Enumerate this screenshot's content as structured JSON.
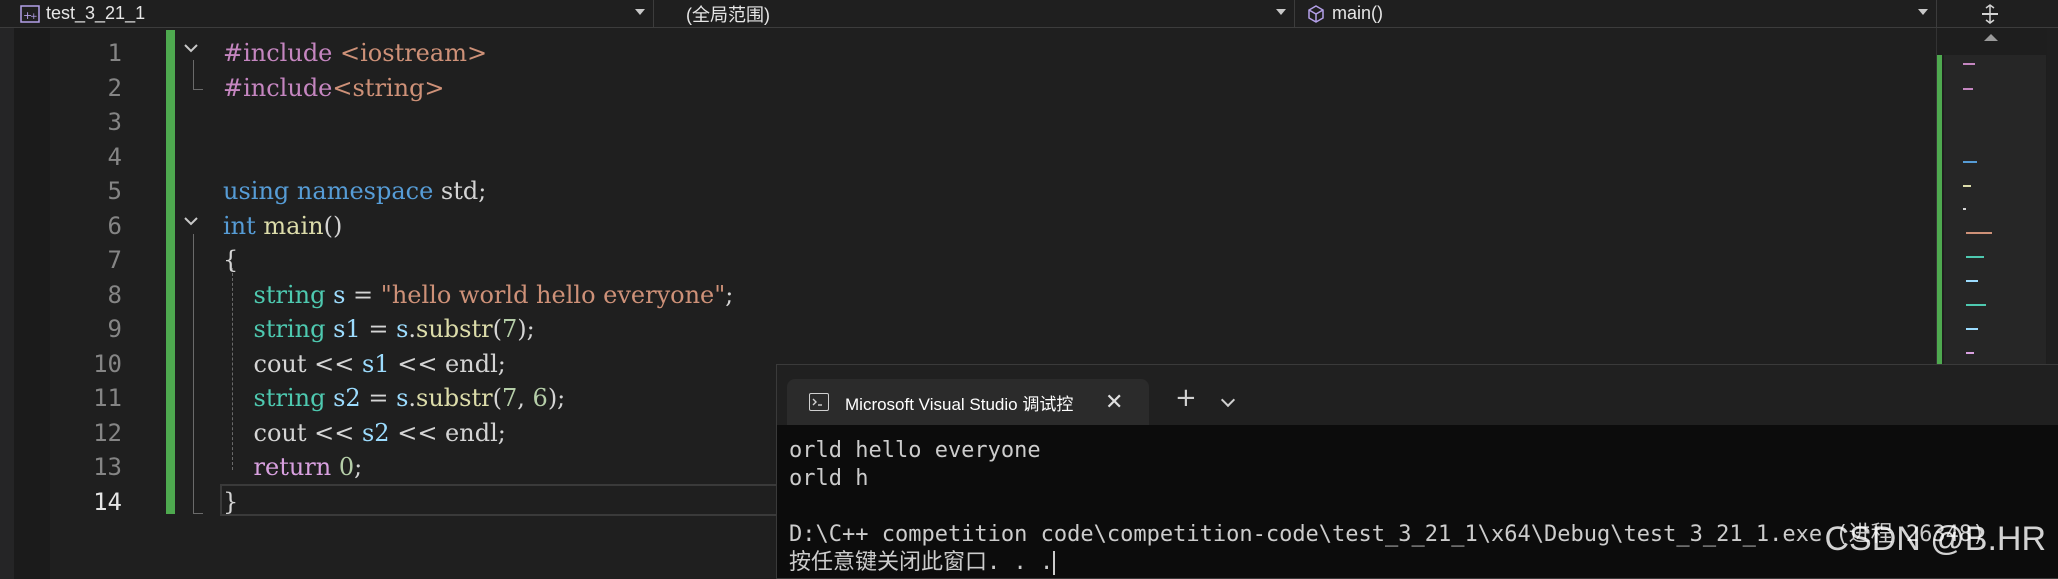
{
  "navbar": {
    "project": "test_3_21_1",
    "scope": "(全局范围)",
    "member": "main()"
  },
  "editor": {
    "line_numbers": [
      "1",
      "2",
      "3",
      "4",
      "5",
      "6",
      "7",
      "8",
      "9",
      "10",
      "11",
      "12",
      "13",
      "14"
    ],
    "current_line": "14",
    "lines": [
      [
        {
          "t": "#include ",
          "c": "pp"
        },
        {
          "t": "<iostream>",
          "c": "str"
        }
      ],
      [
        {
          "t": "#include",
          "c": "pp"
        },
        {
          "t": "<string>",
          "c": "str"
        }
      ],
      [],
      [],
      [
        {
          "t": "using",
          "c": "kw"
        },
        {
          "t": " ",
          "c": "plain"
        },
        {
          "t": "namespace",
          "c": "kw"
        },
        {
          "t": " std;",
          "c": "plain"
        }
      ],
      [
        {
          "t": "int",
          "c": "kw"
        },
        {
          "t": " ",
          "c": "plain"
        },
        {
          "t": "main",
          "c": "fn"
        },
        {
          "t": "()",
          "c": "plain"
        }
      ],
      [
        {
          "t": "{",
          "c": "plain"
        }
      ],
      [
        {
          "t": "    ",
          "c": "plain"
        },
        {
          "t": "string",
          "c": "ty"
        },
        {
          "t": " ",
          "c": "plain"
        },
        {
          "t": "s",
          "c": "var"
        },
        {
          "t": " = ",
          "c": "plain"
        },
        {
          "t": "\"hello world hello everyone\"",
          "c": "str"
        },
        {
          "t": ";",
          "c": "plain"
        }
      ],
      [
        {
          "t": "    ",
          "c": "plain"
        },
        {
          "t": "string",
          "c": "ty"
        },
        {
          "t": " ",
          "c": "plain"
        },
        {
          "t": "s1",
          "c": "var"
        },
        {
          "t": " = ",
          "c": "plain"
        },
        {
          "t": "s",
          "c": "var"
        },
        {
          "t": ".",
          "c": "plain"
        },
        {
          "t": "substr",
          "c": "fn"
        },
        {
          "t": "(",
          "c": "plain"
        },
        {
          "t": "7",
          "c": "num"
        },
        {
          "t": ");",
          "c": "plain"
        }
      ],
      [
        {
          "t": "    cout << ",
          "c": "plain"
        },
        {
          "t": "s1",
          "c": "var"
        },
        {
          "t": " << endl;",
          "c": "plain"
        }
      ],
      [
        {
          "t": "    ",
          "c": "plain"
        },
        {
          "t": "string",
          "c": "ty"
        },
        {
          "t": " ",
          "c": "plain"
        },
        {
          "t": "s2",
          "c": "var"
        },
        {
          "t": " = ",
          "c": "plain"
        },
        {
          "t": "s",
          "c": "var"
        },
        {
          "t": ".",
          "c": "plain"
        },
        {
          "t": "substr",
          "c": "fn"
        },
        {
          "t": "(",
          "c": "plain"
        },
        {
          "t": "7",
          "c": "num"
        },
        {
          "t": ", ",
          "c": "plain"
        },
        {
          "t": "6",
          "c": "num"
        },
        {
          "t": ");",
          "c": "plain"
        }
      ],
      [
        {
          "t": "    cout << ",
          "c": "plain"
        },
        {
          "t": "s2",
          "c": "var"
        },
        {
          "t": " << endl;",
          "c": "plain"
        }
      ],
      [
        {
          "t": "    ",
          "c": "plain"
        },
        {
          "t": "return",
          "c": "ctl"
        },
        {
          "t": " ",
          "c": "plain"
        },
        {
          "t": "0",
          "c": "num"
        },
        {
          "t": ";",
          "c": "plain"
        }
      ],
      [
        {
          "t": "}",
          "c": "plain"
        }
      ]
    ]
  },
  "terminal": {
    "tab_title": "Microsoft Visual Studio 调试控",
    "output": [
      "orld hello everyone",
      "orld h",
      "",
      "D:\\C++ competition code\\competition-code\\test_3_21_1\\x64\\Debug\\test_3_21_1.exe (进程 26348)",
      "按任意键关闭此窗口. . ."
    ]
  },
  "watermark": "CSDN @B.HR",
  "colors": {
    "background": "#1f1f1f",
    "change_bar": "#4ea94f",
    "keyword": "#569cd6",
    "type": "#4ec9b0",
    "function": "#dcdcaa",
    "string": "#ce9178",
    "number": "#b5cea8",
    "variable": "#9cdcfe",
    "terminal_bg": "#0c0c0c"
  },
  "icons": {
    "project": "cpp-project-icon",
    "member": "cube-icon",
    "split": "split-editor-icon",
    "terminal_tab": "console-icon",
    "terminal_close": "close-icon",
    "terminal_new": "plus-icon",
    "terminal_dropdown": "chevron-down-icon"
  }
}
